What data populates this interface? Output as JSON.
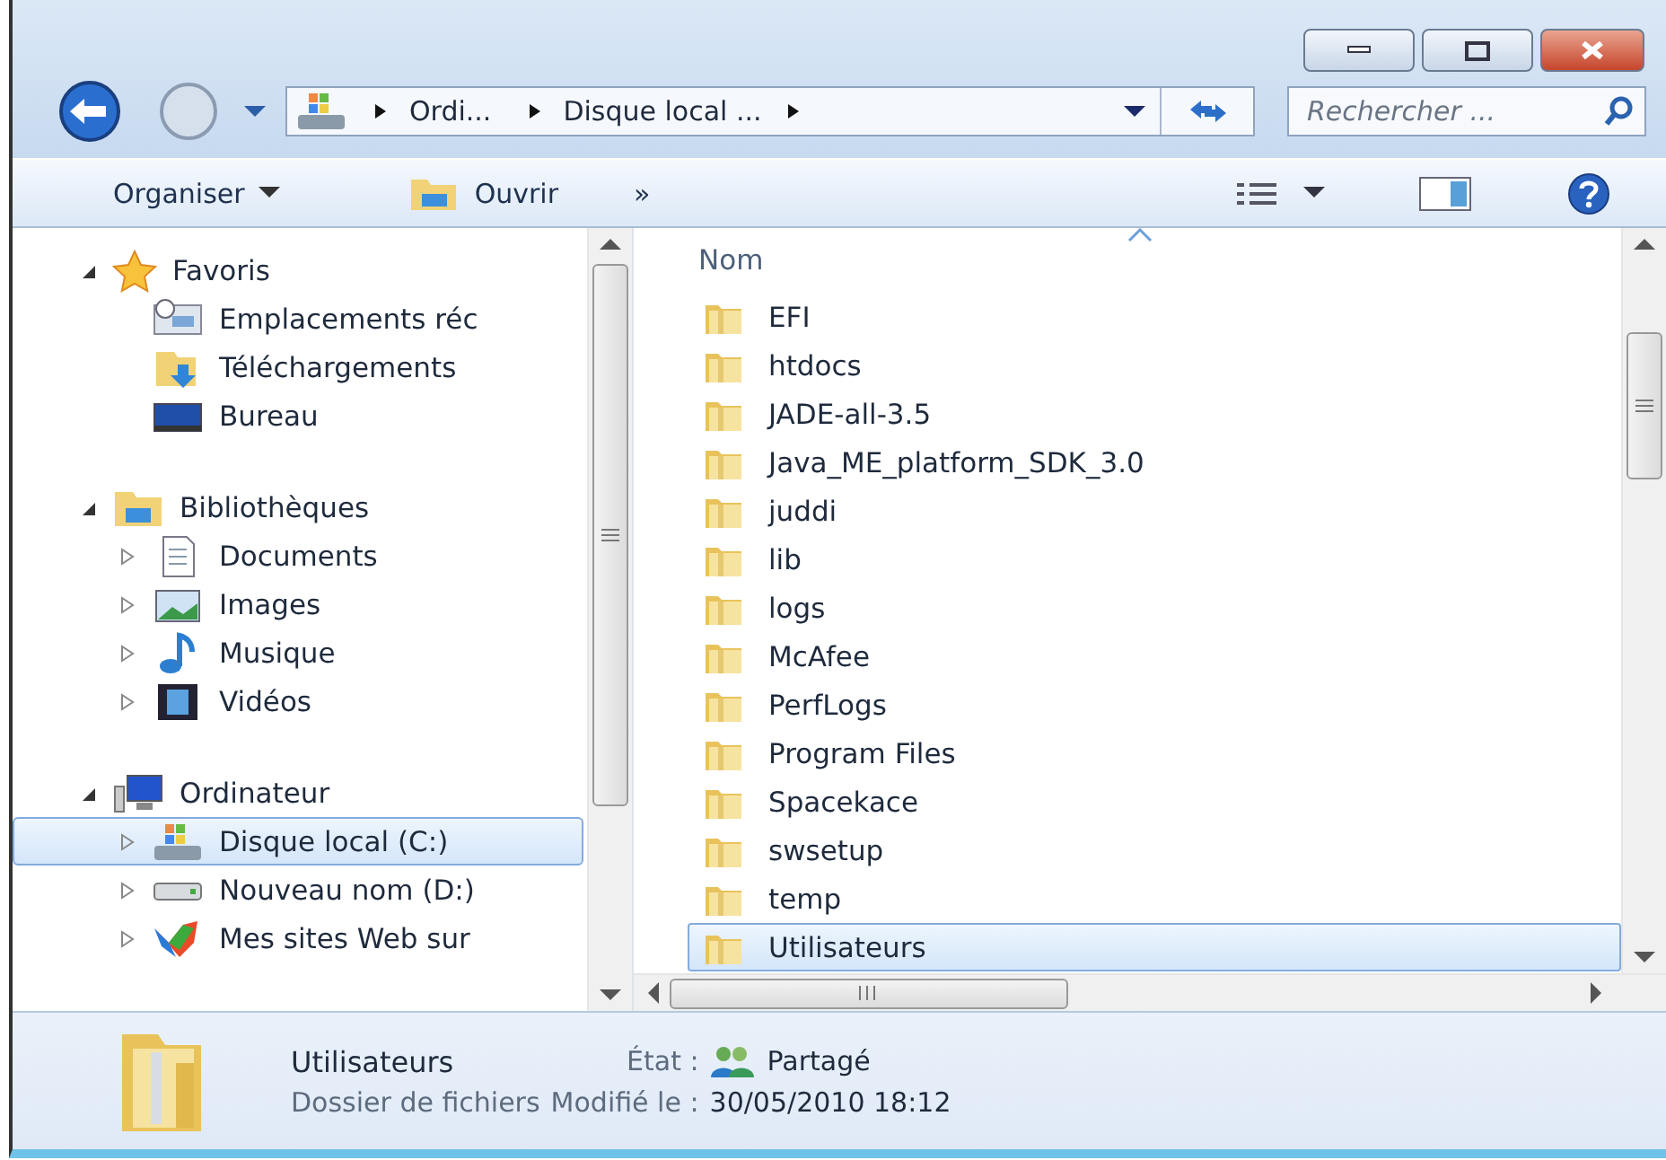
{
  "window": {
    "buttons": [
      {
        "kind": "minimize"
      },
      {
        "kind": "maximize"
      },
      {
        "kind": "close"
      }
    ]
  },
  "address_bar": {
    "crumbs": [
      "Ordi...",
      "Disque local ..."
    ]
  },
  "search": {
    "placeholder": "Rechercher ..."
  },
  "toolbar": {
    "organize": "Organiser",
    "open": "Ouvrir",
    "overflow": "»"
  },
  "navigation": [
    {
      "label": "Favoris",
      "expanded": true,
      "selected": false,
      "children": [
        {
          "label": "Emplacements réc",
          "selected": false
        },
        {
          "label": "Téléchargements",
          "selected": false
        },
        {
          "label": "Bureau",
          "selected": false
        }
      ]
    },
    {
      "label": "Bibliothèques",
      "expanded": true,
      "selected": false,
      "children": [
        {
          "label": "Documents",
          "expanded": false,
          "selected": false
        },
        {
          "label": "Images",
          "expanded": false,
          "selected": false
        },
        {
          "label": "Musique",
          "expanded": false,
          "selected": false
        },
        {
          "label": "Vidéos",
          "expanded": false,
          "selected": false
        }
      ]
    },
    {
      "label": "Ordinateur",
      "expanded": true,
      "selected": false,
      "children": [
        {
          "label": "Disque local (C:)",
          "expanded": false,
          "selected": true
        },
        {
          "label": "Nouveau nom (D:)",
          "expanded": false,
          "selected": false
        },
        {
          "label": "Mes sites Web sur",
          "expanded": false,
          "selected": false
        }
      ]
    }
  ],
  "file_list": {
    "column": "Nom",
    "rows": [
      {
        "name": "EFI",
        "selected": false
      },
      {
        "name": "htdocs",
        "selected": false
      },
      {
        "name": "JADE-all-3.5",
        "selected": false
      },
      {
        "name": "Java_ME_platform_SDK_3.0",
        "selected": false
      },
      {
        "name": "juddi",
        "selected": false
      },
      {
        "name": "lib",
        "selected": false
      },
      {
        "name": "logs",
        "selected": false
      },
      {
        "name": "McAfee",
        "selected": false
      },
      {
        "name": "PerfLogs",
        "selected": false
      },
      {
        "name": "Program Files",
        "selected": false
      },
      {
        "name": "Spacekace",
        "selected": false
      },
      {
        "name": "swsetup",
        "selected": false
      },
      {
        "name": "temp",
        "selected": false
      },
      {
        "name": "Utilisateurs",
        "selected": true
      }
    ]
  },
  "details": {
    "name": "Utilisateurs",
    "type": "Dossier de fichiers",
    "fields": [
      {
        "label": "État :",
        "value": "Partagé",
        "kind": "shared"
      },
      {
        "label": "Modifié le :",
        "value": "30/05/2010 18:12",
        "kind": "plain"
      }
    ]
  }
}
